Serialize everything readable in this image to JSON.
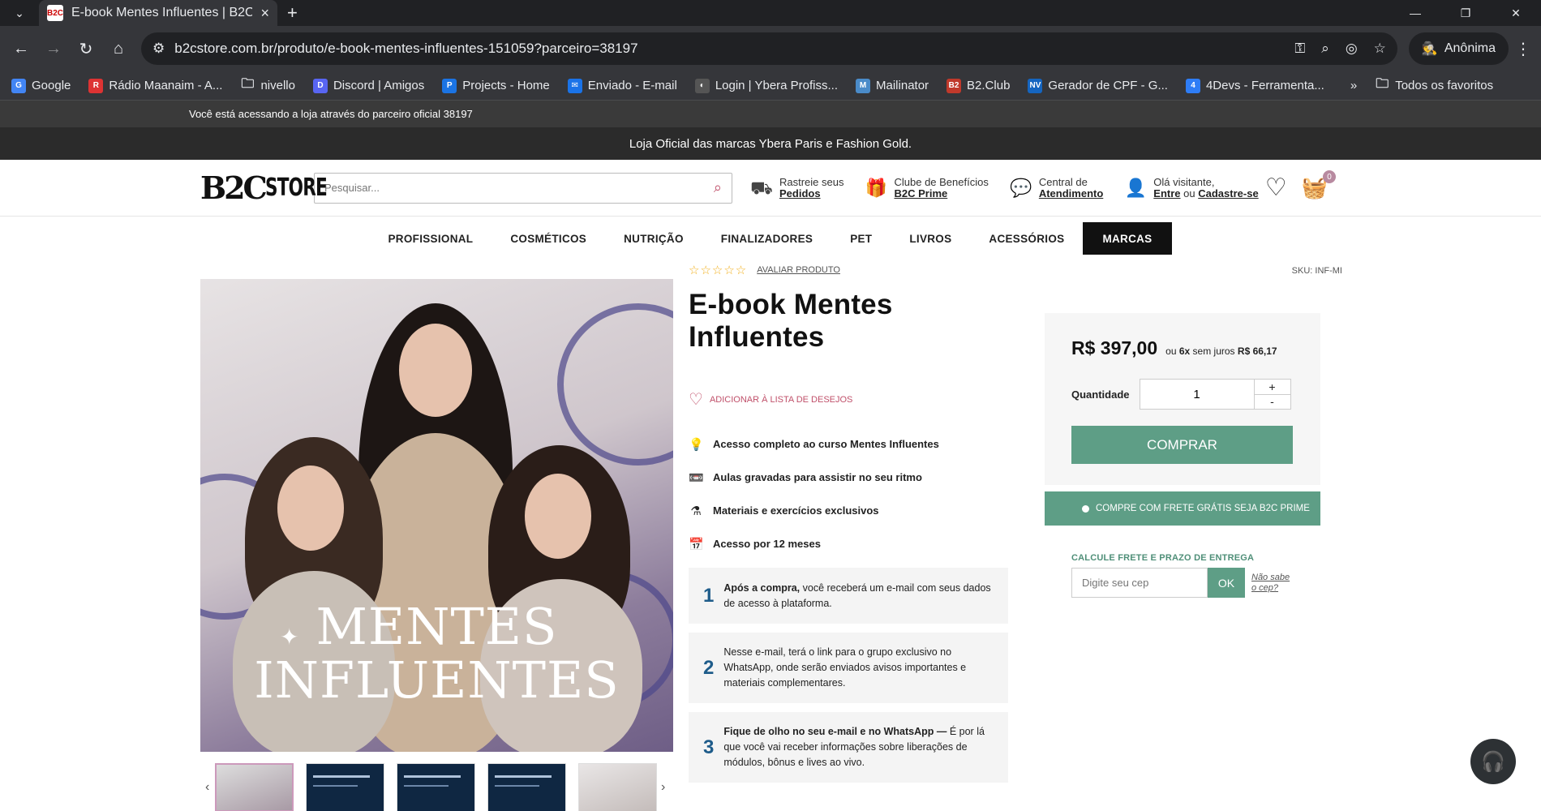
{
  "browser": {
    "tab_title": "E-book Mentes Influentes | B2C",
    "tab_favicon": "B2C",
    "url": "b2cstore.com.br/produto/e-book-mentes-influentes-151059?parceiro=38197",
    "profile_label": "Anônima",
    "bookmarks": [
      {
        "label": "Google",
        "icon_text": "G",
        "color": "#4285f4"
      },
      {
        "label": "Rádio Maanaim - A...",
        "icon_text": "R",
        "color": "#d33"
      },
      {
        "label": "nivello",
        "icon_text": "",
        "color": "folder"
      },
      {
        "label": "Discord | Amigos",
        "icon_text": "D",
        "color": "#5865f2"
      },
      {
        "label": "Projects - Home",
        "icon_text": "P",
        "color": "#1b74e4"
      },
      {
        "label": "Enviado - E-mail",
        "icon_text": "✉",
        "color": "#1a73e8"
      },
      {
        "label": "Login | Ybera Profiss...",
        "icon_text": "◐",
        "color": "#555"
      },
      {
        "label": "Mailinator",
        "icon_text": "M",
        "color": "#4a8bc9"
      },
      {
        "label": "B2.Club",
        "icon_text": "B2",
        "color": "#c0392b"
      },
      {
        "label": "Gerador de CPF - G...",
        "icon_text": "NV",
        "color": "#1565c0"
      },
      {
        "label": "4Devs - Ferramenta...",
        "icon_text": "4",
        "color": "#2e7df6"
      }
    ],
    "bookmarks_overflow": "»",
    "all_bookmarks": "Todos os favoritos"
  },
  "site": {
    "partner_notice": "Você está acessando a loja através do parceiro oficial 38197",
    "promo": "Loja Oficial das marcas Ybera Paris e Fashion Gold.",
    "logo_b2c": "B2C",
    "logo_store": "STORE",
    "search_placeholder": "Pesquisar...",
    "header_links": [
      {
        "line1": "Rastreie seus",
        "line2": "Pedidos",
        "icon": "truck-icon"
      },
      {
        "line1": "Clube de Benefícios",
        "line2": "B2C Prime",
        "icon": "gift-box-icon"
      },
      {
        "line1": "Central de",
        "line2": "Atendimento",
        "icon": "chat-bubble-icon"
      }
    ],
    "account": {
      "line1": "Olá visitante,",
      "login": "Entre",
      "or": "ou",
      "signup": "Cadastre-se"
    },
    "cart_count": "0",
    "categories": [
      "PROFISSIONAL",
      "COSMÉTICOS",
      "NUTRIÇÃO",
      "FINALIZADORES",
      "PET",
      "LIVROS",
      "ACESSÓRIOS",
      "MARCAS"
    ]
  },
  "product": {
    "rating_stars": "☆☆☆☆☆",
    "rate_link": "AVALIAR PRODUTO",
    "sku": "SKU: INF-MI",
    "title": "E-book Mentes Influentes",
    "wishlist": "ADICIONAR À LISTA DE DESEJOS",
    "cover_line1": "MENTES",
    "cover_line2": "INFLUENTES",
    "features": [
      {
        "icon": "💡",
        "text": "Acesso completo ao curso Mentes Influentes"
      },
      {
        "icon": "📼",
        "text": "Aulas gravadas para assistir no seu ritmo"
      },
      {
        "icon": "⚗",
        "text": "Materiais e exercícios exclusivos"
      },
      {
        "icon": "📅",
        "text": "Acesso por 12 meses"
      }
    ],
    "steps": [
      {
        "num": "1",
        "bold": "Após a compra,",
        "text": " você receberá um e-mail com seus dados de acesso à plataforma."
      },
      {
        "num": "2",
        "bold": "",
        "text": "Nesse e-mail, terá o link para o grupo exclusivo no WhatsApp, onde serão enviados avisos importantes e materiais complementares."
      },
      {
        "num": "3",
        "bold": "Fique de olho no seu e-mail e no WhatsApp —",
        "text": " É por lá que você vai receber informações sobre liberações de módulos, bônus e lives ao vivo."
      }
    ],
    "price": "R$ 397,00",
    "installments_prefix": "ou",
    "installments_count": "6x",
    "installments_mid": "sem juros",
    "installments_value": "R$ 66,17",
    "qty_label": "Quantidade",
    "qty_value": "1",
    "qty_plus": "+",
    "qty_minus": "-",
    "buy_label": "COMPRAR",
    "prime_label": "COMPRE COM FRETE GRÁTIS SEJA B2C PRIME",
    "cep_title": "CALCULE FRETE E PRAZO DE ENTREGA",
    "cep_placeholder": "Digite seu cep",
    "cep_ok": "OK",
    "cep_help": "Não sabe o cep?"
  },
  "colors": {
    "accent_green": "#5e9e86",
    "accent_pink": "#c0506a",
    "dark": "#111111"
  }
}
